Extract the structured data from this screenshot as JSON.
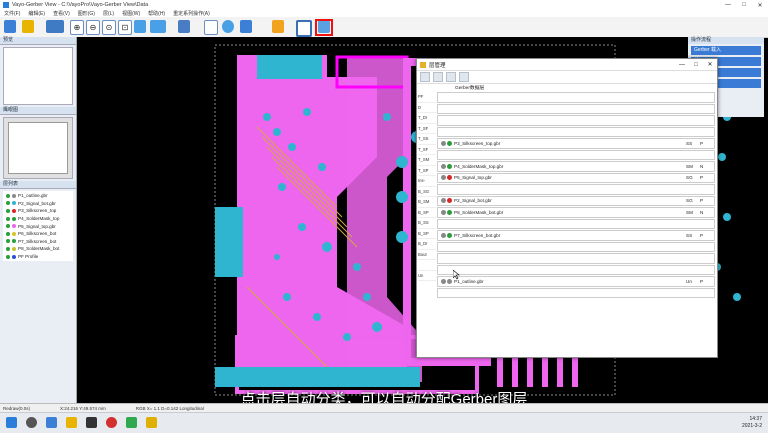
{
  "window": {
    "title": "Vayo-Gerber View - C:\\VayoPro\\Vayo-Gerber View\\Data",
    "minimize": "—",
    "maximize": "□",
    "close": "✕"
  },
  "menu": [
    "文件(F)",
    "编辑(E)",
    "查看(V)",
    "图形(G)",
    "层(L)",
    "视图(W)",
    "帮助(H)",
    "重定系列操作(A)"
  ],
  "left_panel": {
    "panel_title_1": "预览",
    "panel_title_2": "鹰眼图",
    "panel_title_3": "层列表",
    "layers": [
      {
        "name": "P1_outline.gbr",
        "color": "#8a8a8a"
      },
      {
        "name": "P2_Signal_bot.gbr",
        "color": "#2fb5d0"
      },
      {
        "name": "P3_Silkscreen_top",
        "color": "#d92626"
      },
      {
        "name": "P4_SolderMask_top",
        "color": "#2a9d3a"
      },
      {
        "name": "P5_Signal_top.gbr",
        "color": "#ee66ee"
      },
      {
        "name": "P6_Silkscreen_bot",
        "color": "#d9c52a"
      },
      {
        "name": "P7_Silkscreen_bot",
        "color": "#2a9d3a"
      },
      {
        "name": "P8_SolderMask_bot",
        "color": "#c9c42a"
      },
      {
        "name": "PF Profile",
        "color": "#2a4ed9"
      }
    ]
  },
  "right_panel": {
    "title": "操作流程",
    "buttons": [
      "Gerber 载入",
      "载入",
      "",
      ""
    ]
  },
  "dialog": {
    "title": "层管理",
    "column_header": "Gerber数据层",
    "row_labels": [
      "PF",
      "D",
      "T_Dr",
      "T_SF",
      "T_SS",
      "T_SF",
      "T_SM",
      "T_SP",
      "Ins-",
      "B_SG",
      "B_SM",
      "B_SP",
      "B_SS",
      "B_SP",
      "B_Dr",
      "Bout",
      "",
      "Un"
    ],
    "rows": [
      {
        "file": "",
        "dot": "",
        "t1": "",
        "t2": ""
      },
      {
        "file": "",
        "dot": "",
        "t1": "",
        "t2": ""
      },
      {
        "file": "",
        "dot": "",
        "t1": "",
        "t2": ""
      },
      {
        "file": "",
        "dot": "",
        "t1": "",
        "t2": ""
      },
      {
        "file": "P3_Silkscreen_top.gbr",
        "dot": "#2a9d3a",
        "t1": "SS",
        "t2": "P"
      },
      {
        "file": "",
        "dot": "",
        "t1": "",
        "t2": ""
      },
      {
        "file": "P4_SolderMask_top.gbr",
        "dot": "#2a9d3a",
        "t1": "SM",
        "t2": "N"
      },
      {
        "file": "P5_Signal_top.gbr",
        "dot": "#d92626",
        "t1": "SG",
        "t2": "P"
      },
      {
        "file": "",
        "dot": "",
        "t1": "",
        "t2": ""
      },
      {
        "file": "P2_Signal_bot.gbr",
        "dot": "#d92626",
        "t1": "SG",
        "t2": "P"
      },
      {
        "file": "P8_SolderMask_bot.gbr",
        "dot": "#2a9d3a",
        "t1": "SM",
        "t2": "N"
      },
      {
        "file": "",
        "dot": "",
        "t1": "",
        "t2": ""
      },
      {
        "file": "P7_Silkscreen_bot.gbr",
        "dot": "#2a9d3a",
        "t1": "SS",
        "t2": "P"
      },
      {
        "file": "",
        "dot": "",
        "t1": "",
        "t2": ""
      },
      {
        "file": "",
        "dot": "",
        "t1": "",
        "t2": ""
      },
      {
        "file": "",
        "dot": "",
        "t1": "",
        "t2": ""
      },
      {
        "file": "P1_outline.gbr",
        "dot": "#8a8a8a",
        "t1": "Un",
        "t2": "P"
      },
      {
        "file": "",
        "dot": "",
        "t1": "",
        "t2": ""
      }
    ]
  },
  "subtitle": "点击层自动分类，可以自动分配Gerber图层",
  "statusbar": {
    "left": "Redraw(0.0s)",
    "coords": "X:24.216  Y:49.574 mm",
    "right": "RGB  X=  1.1  D=0.142 Longitudinal"
  },
  "clock": {
    "time": "14:37",
    "date": "2021-3-2"
  },
  "colors": {
    "board": "#ee66ee",
    "pad": "#2fb5d0",
    "highlight": "#e11111"
  }
}
